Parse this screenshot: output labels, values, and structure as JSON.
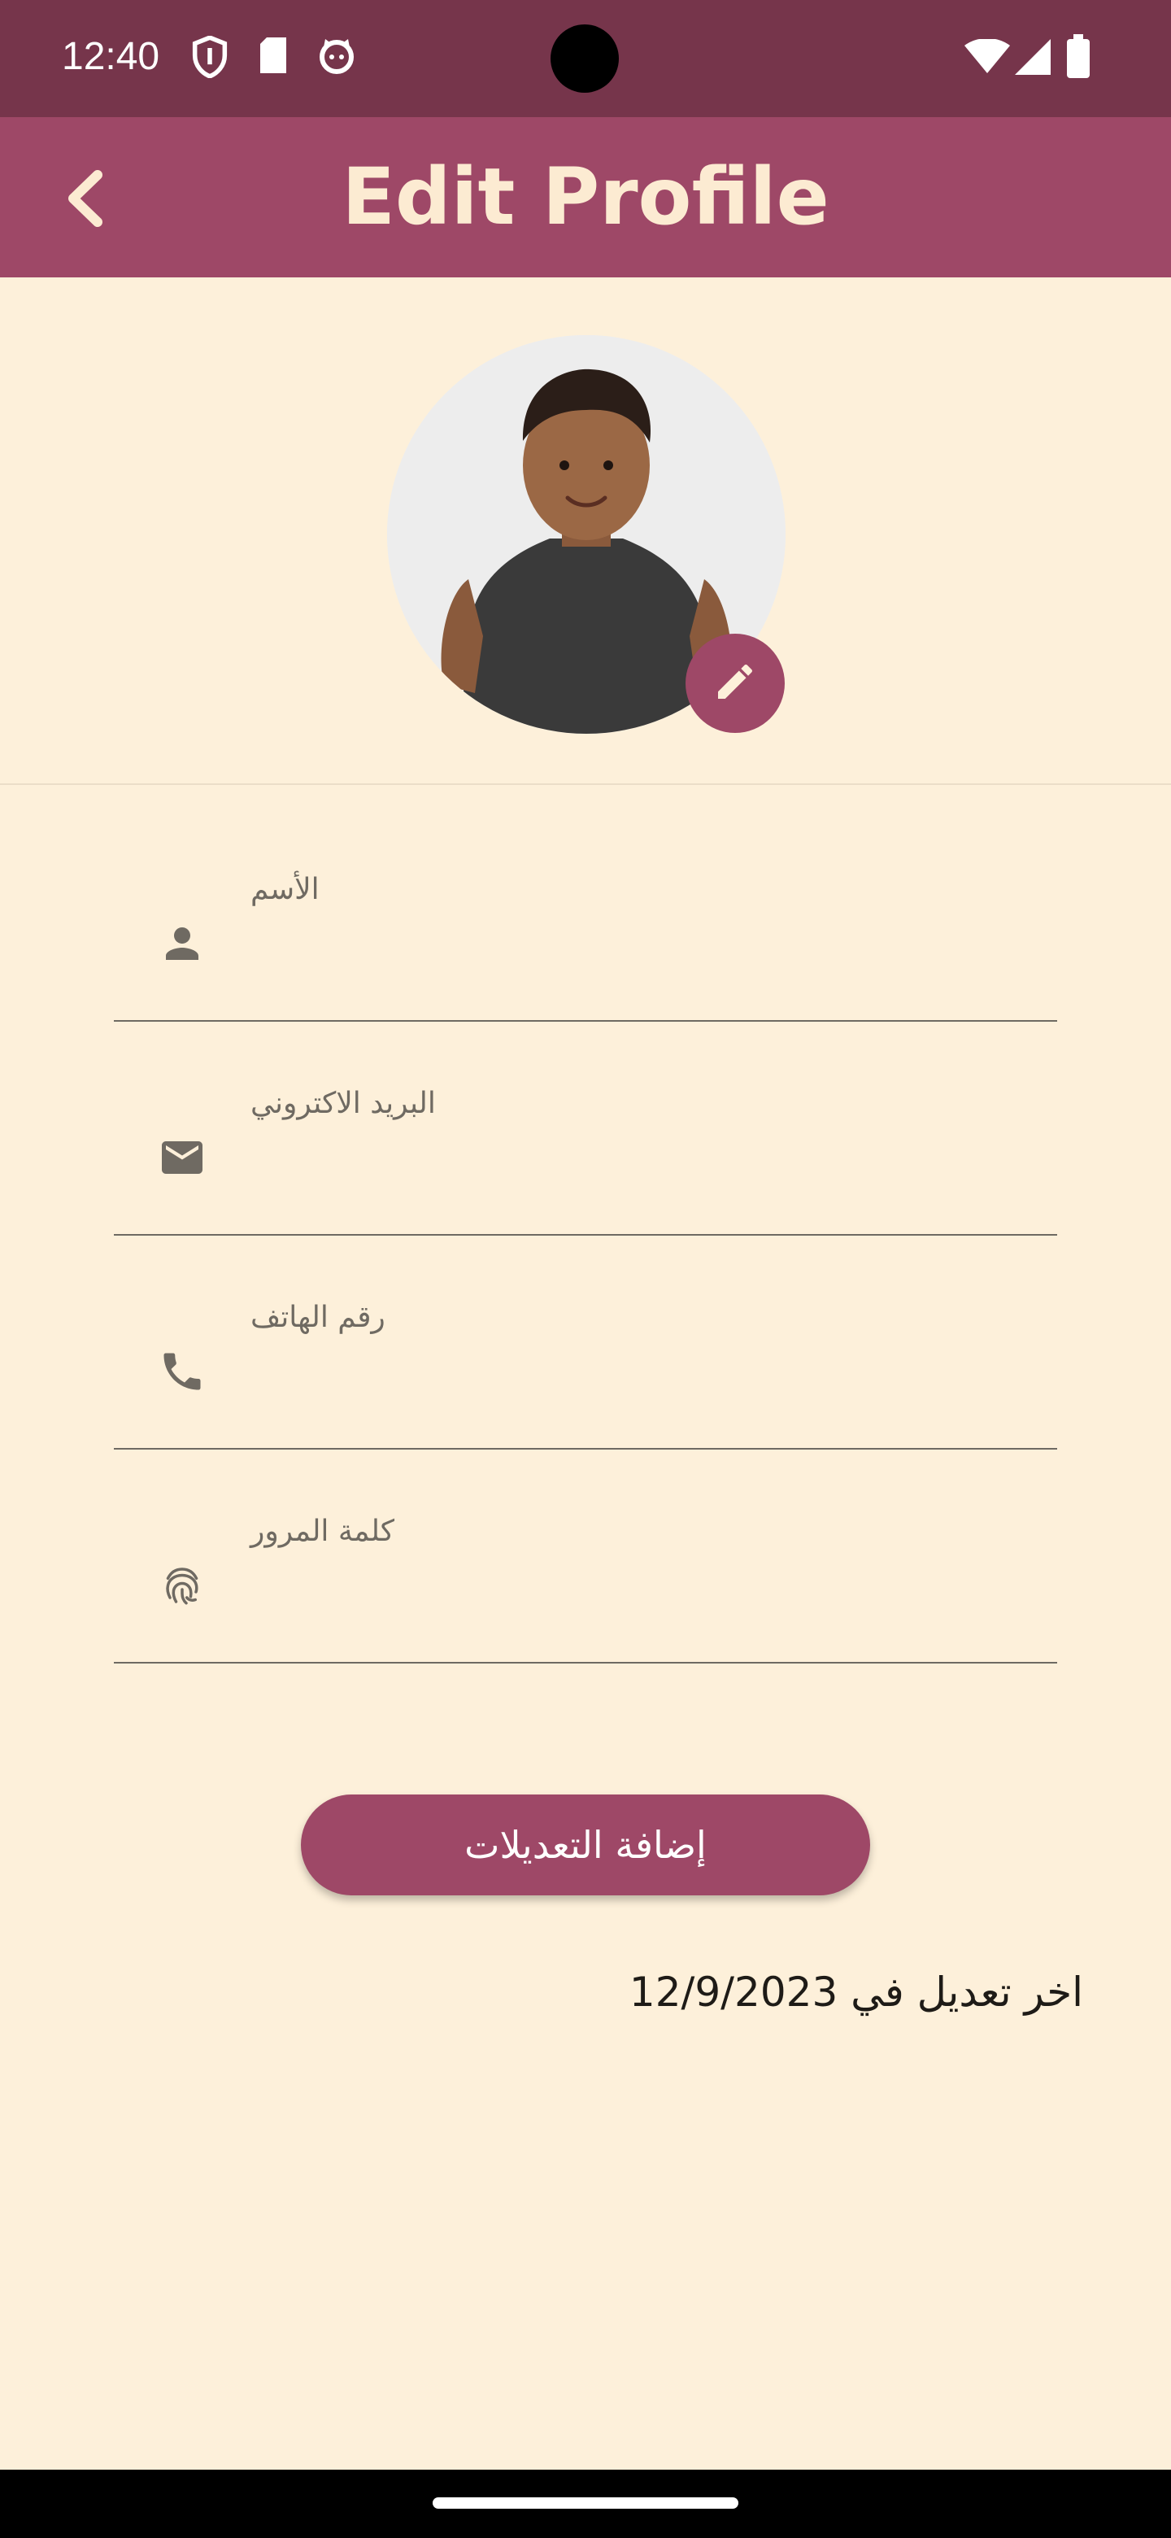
{
  "status_bar": {
    "time": "12:40",
    "icons": [
      "shield-icon",
      "sd-card-icon",
      "cat-face-icon",
      "wifi-icon",
      "signal-icon",
      "battery-icon"
    ]
  },
  "app_bar": {
    "title": "Edit Profile",
    "back_icon": "chevron-left-icon"
  },
  "profile": {
    "edit_icon": "pencil-icon"
  },
  "form": {
    "fields": [
      {
        "label": "الأسم",
        "icon": "person-icon",
        "value": ""
      },
      {
        "label": "البريد الاكتروني",
        "icon": "mail-icon",
        "value": ""
      },
      {
        "label": "رقم الهاتف",
        "icon": "phone-icon",
        "value": ""
      },
      {
        "label": "كلمة المرور",
        "icon": "fingerprint-icon",
        "value": ""
      }
    ],
    "submit_label": "إضافة التعديلات"
  },
  "last_edit": "اخر تعديل في 12/9/2023",
  "colors": {
    "status_bar": "#76354B",
    "app_bar": "#9E4867",
    "background": "#FDF0DA",
    "title_text": "#FCEBD2",
    "accent": "#9E4867"
  }
}
